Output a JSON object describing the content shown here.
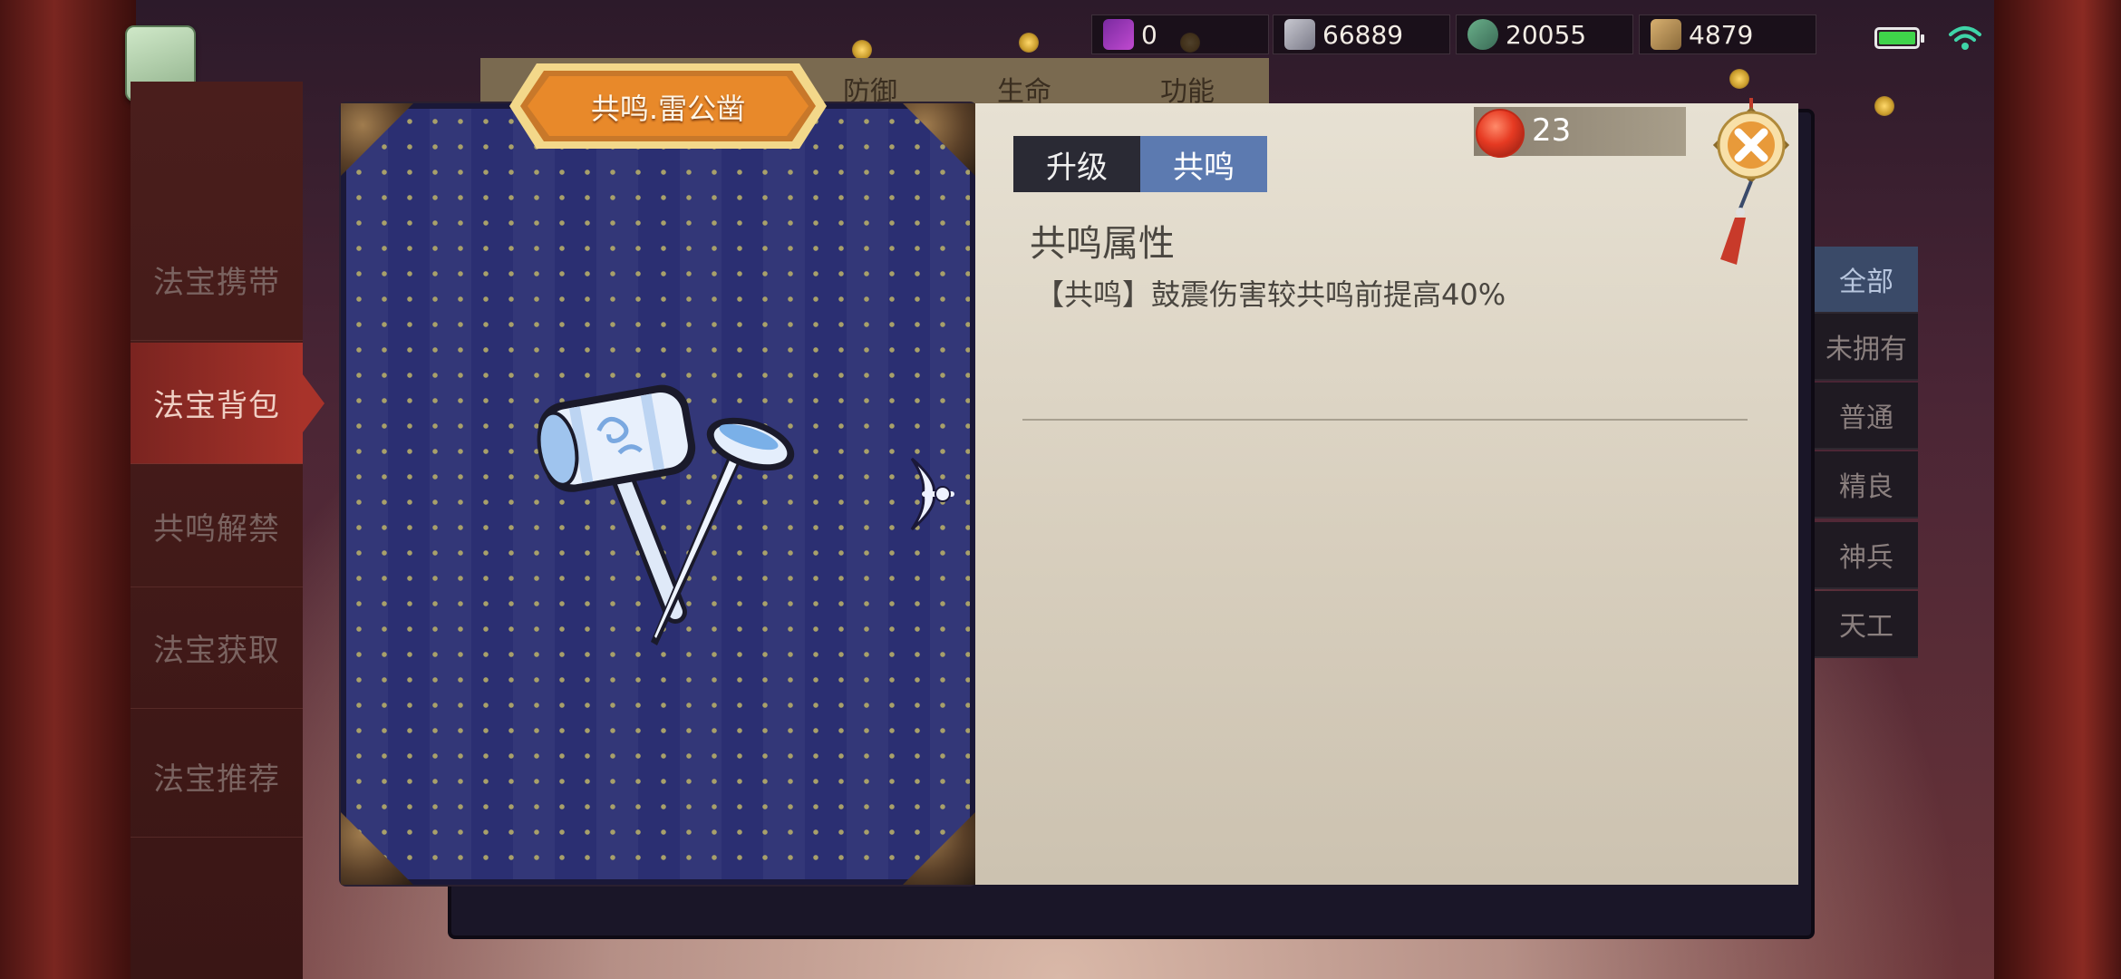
{
  "resources": [
    {
      "icon": "scroll-icon",
      "value": "0"
    },
    {
      "icon": "silver-icon",
      "value": "66889"
    },
    {
      "icon": "jade-icon",
      "value": "20055"
    },
    {
      "icon": "gate-token-icon",
      "value": "4879"
    }
  ],
  "left_menu": [
    {
      "label": "法宝携带",
      "active": false
    },
    {
      "label": "法宝背包",
      "active": true
    },
    {
      "label": "共鸣解禁",
      "active": false
    },
    {
      "label": "法宝获取",
      "active": false
    },
    {
      "label": "法宝推荐",
      "active": false
    }
  ],
  "filters": [
    {
      "label": "全部",
      "active": true
    },
    {
      "label": "未拥有",
      "active": false
    },
    {
      "label": "普通",
      "active": false
    },
    {
      "label": "精良",
      "active": false
    },
    {
      "label": "神兵",
      "active": false
    },
    {
      "label": "天工",
      "active": false
    }
  ],
  "back_tabs": [
    "防御",
    "生命",
    "功能"
  ],
  "treasure": {
    "title": "共鸣.雷公凿"
  },
  "detail": {
    "tabs": {
      "upgrade": "升级",
      "resonance": "共鸣"
    },
    "active_tab": "resonance",
    "currency": {
      "icon": "red-gem-icon",
      "value": "23"
    },
    "section_title": "共鸣属性",
    "attribute": "【共鸣】鼓震伤害较共鸣前提高40%"
  },
  "status": {
    "battery_color": "#3fd44a",
    "wifi_color": "#3fd4a8"
  },
  "colors": {
    "active_menu": "#a8332a",
    "active_tab": "#5c7ab0",
    "pattern_bg": "#2b2f72"
  }
}
